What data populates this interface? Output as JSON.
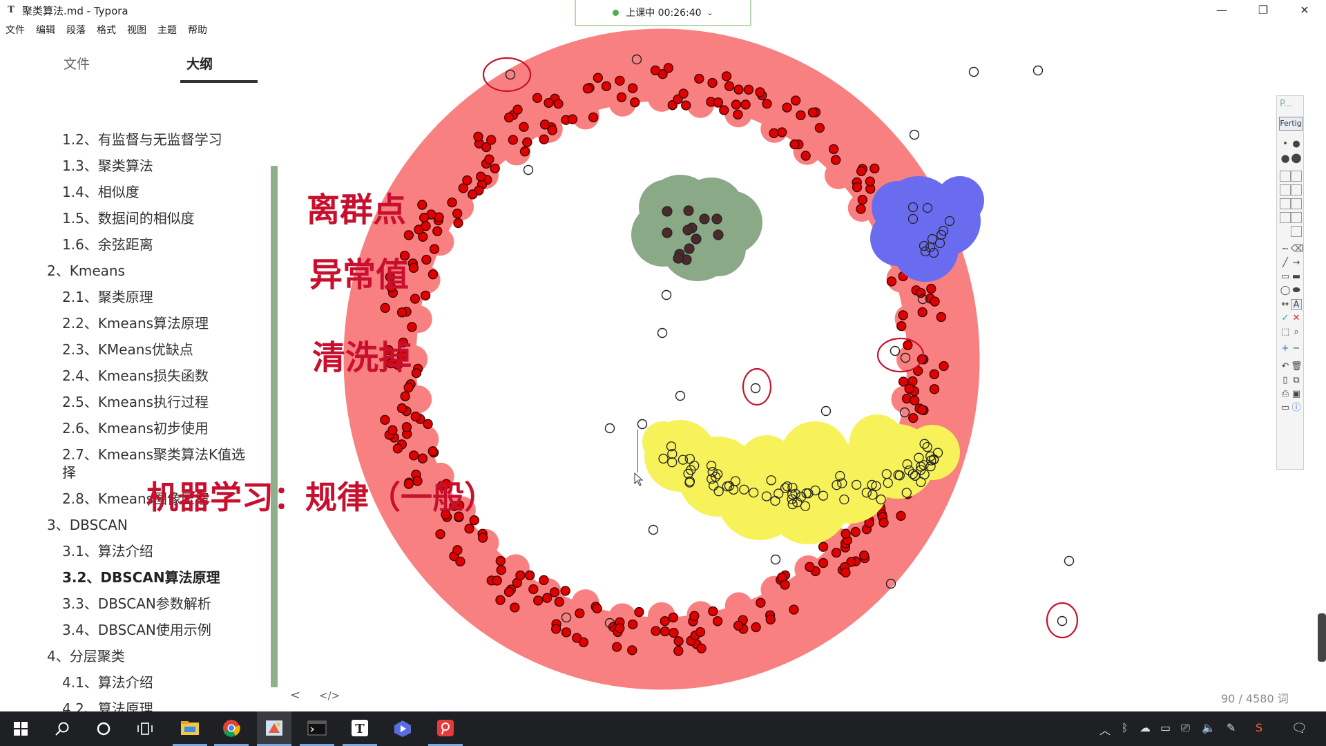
{
  "window": {
    "app_icon": "T",
    "title": "聚类算法.md - Typora",
    "min": "—",
    "max": "❐",
    "close": "✕"
  },
  "timer": {
    "label": "上课中 00:26:40",
    "chevron": "⌄"
  },
  "menu": [
    "文件",
    "编辑",
    "段落",
    "格式",
    "视图",
    "主题",
    "帮助"
  ],
  "sidebar": {
    "tabs": [
      "文件",
      "大纲"
    ],
    "items": [
      {
        "label": "1.2、有监督与无监督学习"
      },
      {
        "label": "1.3、聚类算法"
      },
      {
        "label": "1.4、相似度"
      },
      {
        "label": "1.5、数据间的相似度"
      },
      {
        "label": "1.6、余弦距离"
      },
      {
        "label": "2、Kmeans"
      },
      {
        "label": "2.1、聚类原理"
      },
      {
        "label": "2.2、Kmeans算法原理"
      },
      {
        "label": "2.3、KMeans优缺点"
      },
      {
        "label": "2.4、Kmeans损失函数"
      },
      {
        "label": "2.5、Kmeans执行过程"
      },
      {
        "label": "2.6、Kmeans初步使用"
      },
      {
        "label": "2.7、Kmeans聚类算法K值选"
      },
      {
        "label": "择"
      },
      {
        "label": "2.8、Kmeans图像压缩"
      },
      {
        "label": "3、DBSCAN"
      },
      {
        "label": "3.1、算法介绍"
      },
      {
        "label": "3.2、DBSCAN算法原理",
        "active": true
      },
      {
        "label": "3.3、DBSCAN参数解析"
      },
      {
        "label": "3.4、DBSCAN使用示例"
      },
      {
        "label": "4、分层聚类"
      },
      {
        "label": "4.1、算法介绍"
      },
      {
        "label": "4.2、算法原理"
      },
      {
        "label": "4.3、参数介绍"
      }
    ]
  },
  "annotations": {
    "outlier": "离群点",
    "anomaly": "异常值",
    "clean": "清洗掉",
    "ml_rule": "机器学习：规律（一般）"
  },
  "footer": {
    "back": "<",
    "code": "</>",
    "word_count": "90 / 4580 词"
  },
  "pen_toolbar": {
    "title": "P...",
    "done": "Fertig",
    "text_tool": "A",
    "colors": [
      "#e8393a",
      "#ffef5a",
      "#8fb08c",
      "#6a6cf0",
      "#4a0a0a"
    ]
  },
  "colors": {
    "ring": "#f98080",
    "dot_red": "#e00000",
    "cluster_green": "#8aa987",
    "cluster_blue": "#6a6cf0",
    "cluster_yellow": "#f7f25a",
    "annotation": "#c8102e"
  },
  "taskbar": {
    "apps": [
      "windows-start",
      "search",
      "task-view",
      "multitasking",
      "file-explorer",
      "chrome",
      "paint",
      "terminal",
      "typora",
      "video-app",
      "pdf-app"
    ],
    "tray_icons": [
      "chevron-up",
      "bluetooth",
      "cloud",
      "battery",
      "network",
      "volume",
      "pen",
      "sogou-input",
      "notifications"
    ]
  }
}
